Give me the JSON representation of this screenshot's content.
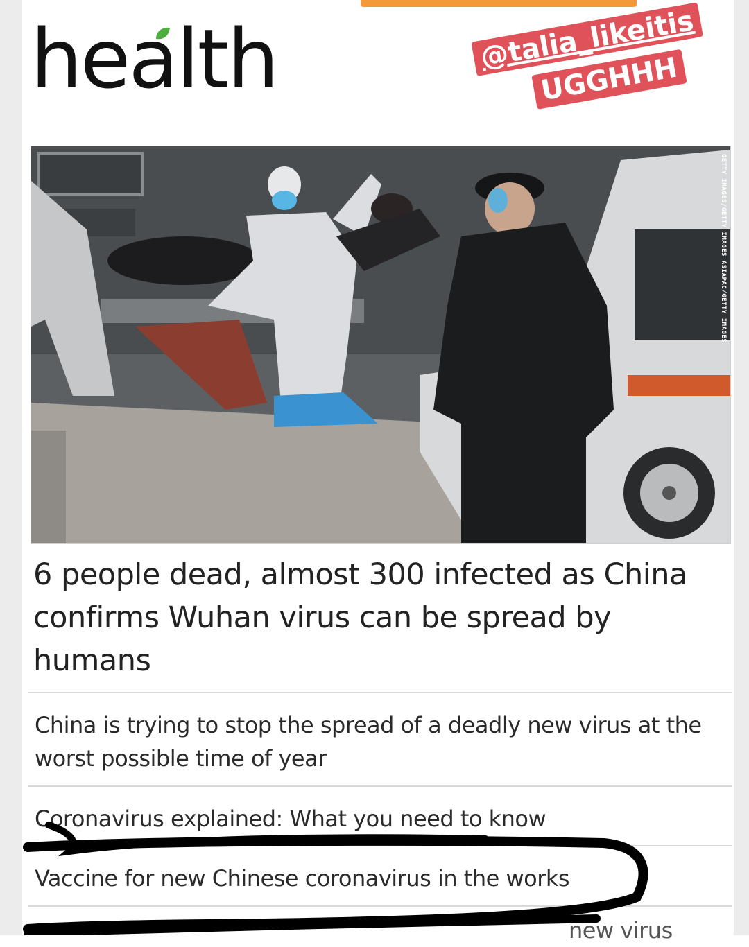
{
  "brand": {
    "logo": "health"
  },
  "stickers": {
    "handle": "@talia_likeitis",
    "reaction": "UGGHHH"
  },
  "photo": {
    "credit": "GETTY IMAGES/GETTY IMAGES ASIAPAC/GETTY IMAGES"
  },
  "headline": "6 people dead, almost 300 infected as China confirms Wuhan virus can be spread by humans",
  "stories": [
    {
      "title": "China is trying to stop the spread of a deadly new virus at the worst possible time of year"
    },
    {
      "title": "Coronavirus explained: What you need to know"
    },
    {
      "title": "Vaccine for new Chinese coronavirus in the works"
    },
    {
      "title": "new virus"
    }
  ],
  "colors": {
    "accent_orange": "#f29a3a",
    "sticker_red": "#e0525a",
    "leaf_green": "#4cae3c",
    "annotation_ink": "#000000"
  }
}
